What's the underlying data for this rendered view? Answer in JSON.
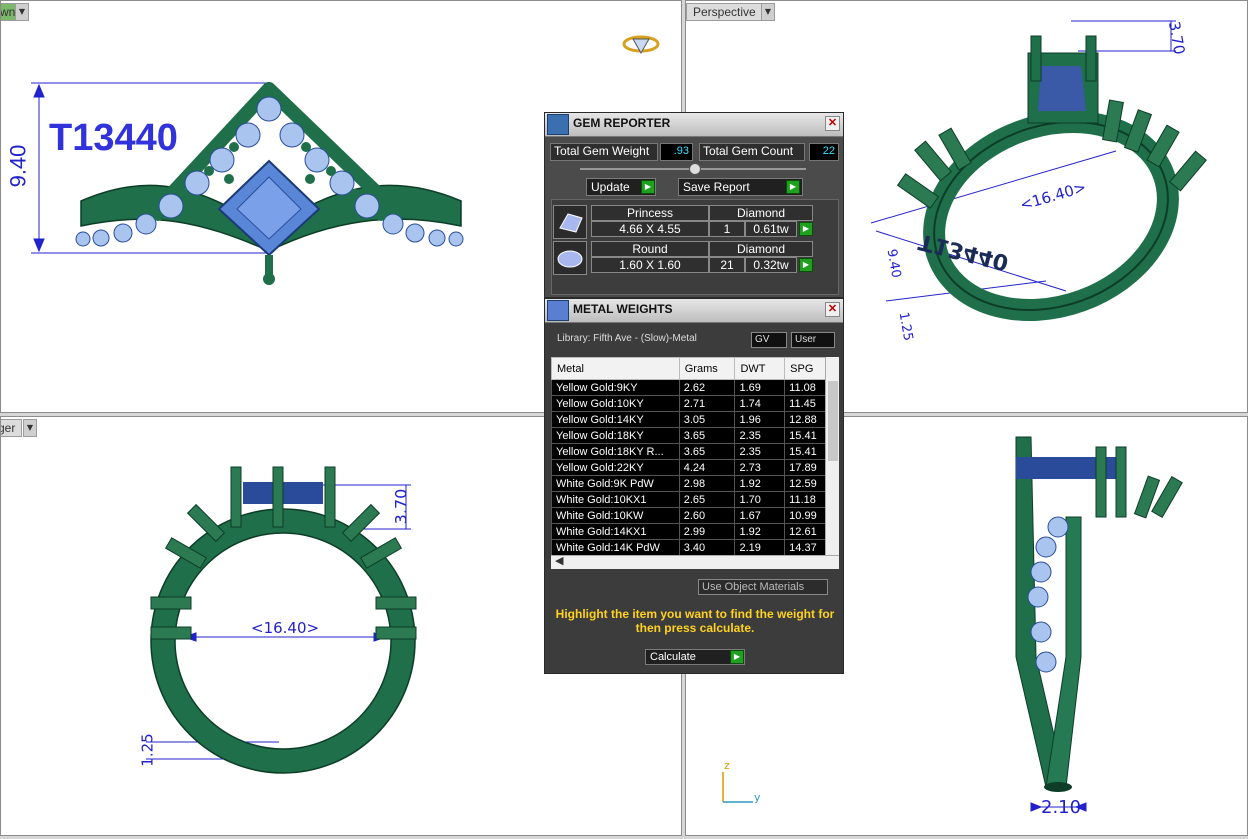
{
  "viewports": {
    "front": {
      "tab": "wn",
      "label_text": "T13440",
      "dim_height": "9.40"
    },
    "perspective": {
      "tab": "Perspective",
      "dim_top": "3.70",
      "dim_width": "<16.40>",
      "dim_side": "9.40",
      "dim_bottom": "1.25",
      "mirror_text": "T13440"
    },
    "right": {
      "tab": "ger",
      "dim_top": "3.70",
      "dim_width": "<16.40>",
      "dim_bottom": "1.25"
    },
    "left": {
      "dim_bottom": "2.10",
      "axis_z": "z",
      "axis_y": "y"
    }
  },
  "gem_reporter": {
    "title": "GEM REPORTER",
    "total_weight_label": "Total Gem Weight",
    "total_weight_value": ".93",
    "total_count_label": "Total Gem Count",
    "total_count_value": "22",
    "update_label": "Update",
    "save_report_label": "Save Report",
    "gems": [
      {
        "shape": "Princess",
        "type": "Diamond",
        "size": "4.66 X 4.55",
        "count": "1",
        "weight": "0.61tw"
      },
      {
        "shape": "Round",
        "type": "Diamond",
        "size": "1.60 X 1.60",
        "count": "21",
        "weight": "0.32tw"
      }
    ]
  },
  "metal_weights": {
    "title": "METAL WEIGHTS",
    "library": "Library: Fifth Ave - (Slow)-Metal",
    "toggle_gv": "GV",
    "toggle_user": "User",
    "columns": [
      "Metal",
      "Grams",
      "DWT",
      "SPG"
    ],
    "rows": [
      [
        "Yellow Gold:9KY",
        "2.62",
        "1.69",
        "11.08"
      ],
      [
        "Yellow Gold:10KY",
        "2.71",
        "1.74",
        "11.45"
      ],
      [
        "Yellow Gold:14KY",
        "3.05",
        "1.96",
        "12.88"
      ],
      [
        "Yellow Gold:18KY",
        "3.65",
        "2.35",
        "15.41"
      ],
      [
        "Yellow Gold:18KY R...",
        "3.65",
        "2.35",
        "15.41"
      ],
      [
        "Yellow Gold:22KY",
        "4.24",
        "2.73",
        "17.89"
      ],
      [
        "White Gold:9K PdW",
        "2.98",
        "1.92",
        "12.59"
      ],
      [
        "White Gold:10KX1",
        "2.65",
        "1.70",
        "11.18"
      ],
      [
        "White Gold:10KW",
        "2.60",
        "1.67",
        "10.99"
      ],
      [
        "White Gold:14KX1",
        "2.99",
        "1.92",
        "12.61"
      ],
      [
        "White Gold:14K PdW",
        "3.40",
        "2.19",
        "14.37"
      ]
    ],
    "use_object_materials": "Use Object Materials",
    "hint": "Highlight the item you want to find the weight for then press calculate.",
    "calculate_label": "Calculate"
  },
  "colors": {
    "metal": "#1e6f4a",
    "gem": "#5a86d8",
    "dimension": "#2222cc"
  }
}
